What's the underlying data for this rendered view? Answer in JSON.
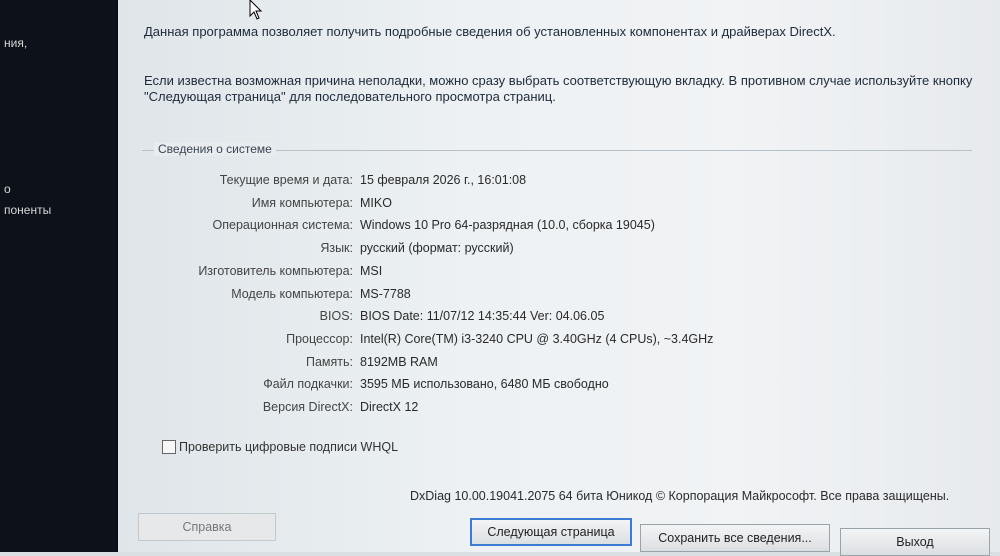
{
  "background_fragments": [
    "ния,",
    "о",
    "поненты"
  ],
  "intro": {
    "line1": "Данная программа позволяет получить подробные сведения об установленных компонентах и драйверах DirectX.",
    "line2": "Если известна возможная причина неполадки, можно сразу выбрать соответствующую вкладку. В противном случае используйте кнопку \"Следующая страница\" для последовательного просмотра страниц."
  },
  "system_info": {
    "title": "Сведения о системе",
    "rows": [
      {
        "label": "Текущие время и дата:",
        "value": "15 февраля 2026 г., 16:01:08"
      },
      {
        "label": "Имя компьютера:",
        "value": "MIKO"
      },
      {
        "label": "Операционная система:",
        "value": "Windows 10 Pro 64-разрядная (10.0, сборка 19045)"
      },
      {
        "label": "Язык:",
        "value": "русский (формат: русский)"
      },
      {
        "label": "Изготовитель компьютера:",
        "value": "MSI"
      },
      {
        "label": "Модель компьютера:",
        "value": "MS-7788"
      },
      {
        "label": "BIOS:",
        "value": "BIOS Date: 11/07/12 14:35:44 Ver: 04.06.05"
      },
      {
        "label": "Процессор:",
        "value": "Intel(R) Core(TM) i3-3240 CPU @ 3.40GHz (4 CPUs), ~3.4GHz"
      },
      {
        "label": "Память:",
        "value": "8192MB RAM"
      },
      {
        "label": "Файл подкачки:",
        "value": "3595 МБ использовано, 6480 МБ свободно"
      },
      {
        "label": "Версия DirectX:",
        "value": "DirectX 12"
      }
    ]
  },
  "whql_checkbox": {
    "label": "Проверить цифровые подписи WHQL",
    "checked": false
  },
  "footer_info": "DxDiag 10.00.19041.2075 64 бита Юникод © Корпорация Майкрософт. Все права защищены.",
  "buttons": {
    "help": "Справка",
    "next_page": "Следующая страница",
    "save_all": "Сохранить все сведения...",
    "exit": "Выход"
  }
}
